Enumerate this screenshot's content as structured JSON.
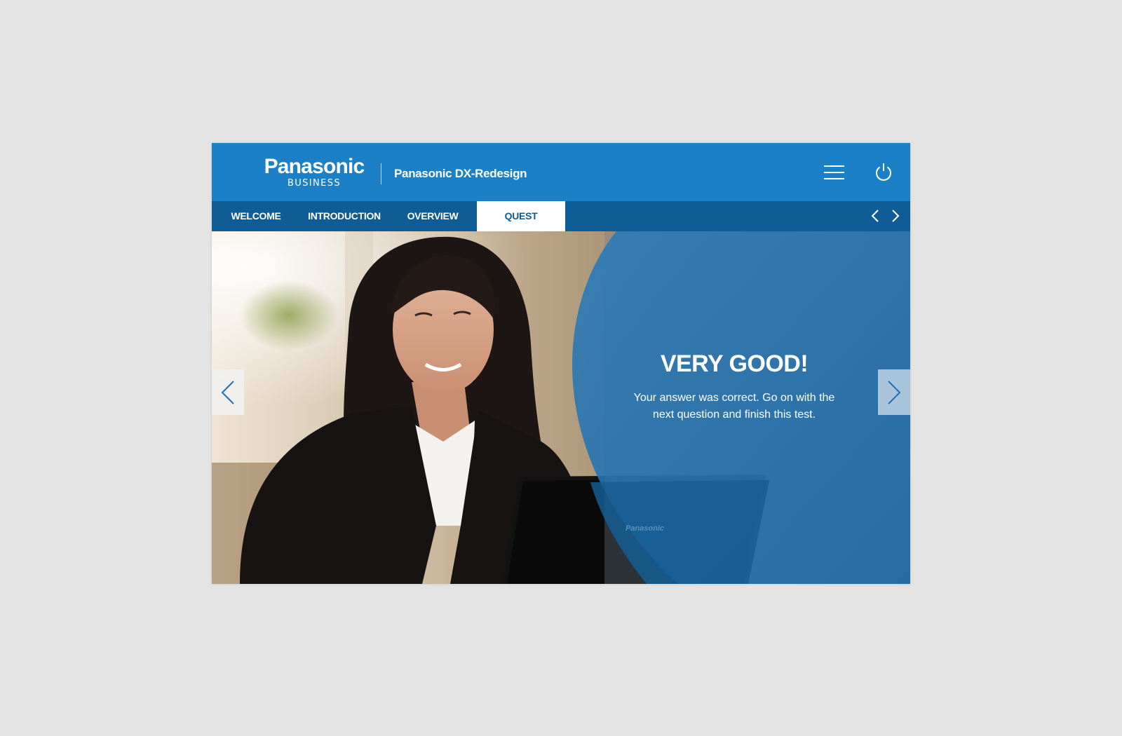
{
  "header": {
    "logo_word": "Panasonic",
    "logo_sub": "BUSINESS",
    "app_title": "Panasonic DX-Redesign",
    "menu_icon": "hamburger-menu-icon",
    "power_icon": "power-icon"
  },
  "tabs": [
    {
      "label": "WELCOME",
      "active": false
    },
    {
      "label": "INTRODUCTION",
      "active": false
    },
    {
      "label": "OVERVIEW",
      "active": false
    },
    {
      "label": "QUEST",
      "active": true
    }
  ],
  "tab_nav": {
    "prev_icon": "chevron-left-icon",
    "next_icon": "chevron-right-icon"
  },
  "hero": {
    "heading": "VERY GOOD!",
    "message": "Your answer was correct. Go on with the next question and finish this test.",
    "laptop_brand": "Panasonic",
    "prev_icon": "chevron-left-icon",
    "next_icon": "chevron-right-icon"
  },
  "colors": {
    "header_blue": "#1b80c6",
    "tabbar_blue": "#0f5c96",
    "overlay_blue": "#1d6fae",
    "page_bg": "#e3e3e3"
  }
}
